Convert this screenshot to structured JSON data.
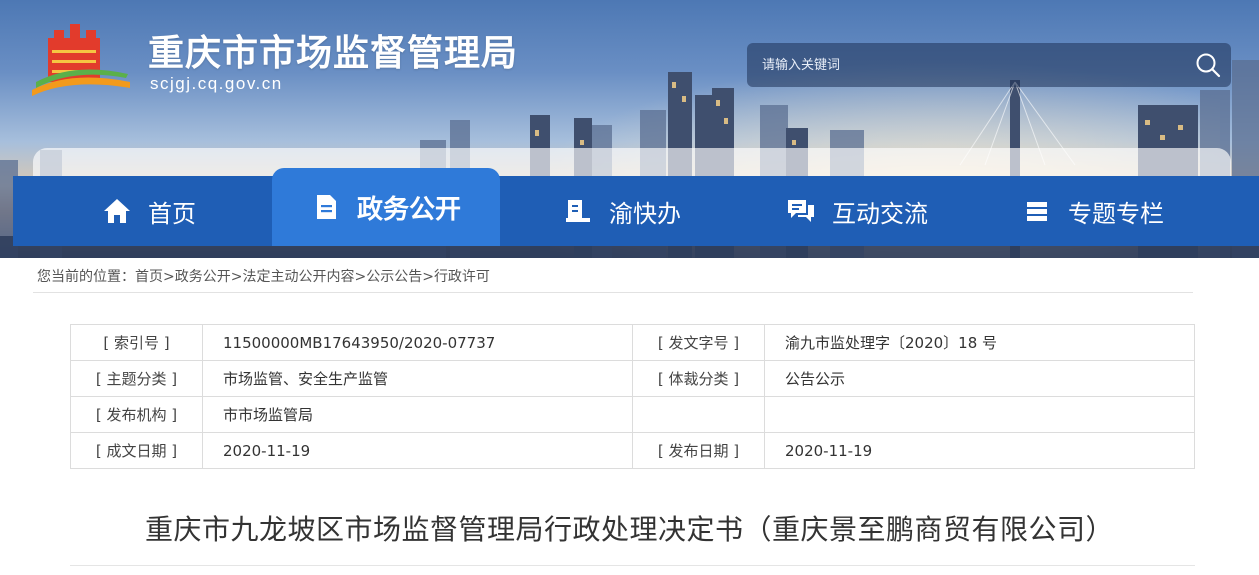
{
  "site": {
    "title": "重庆市市场监督管理局",
    "domain": "scjgj.cq.gov.cn"
  },
  "search": {
    "placeholder": "请输入关键词",
    "icon": "search-icon"
  },
  "nav": {
    "items": [
      {
        "label": "首页",
        "icon": "home-icon",
        "active": false
      },
      {
        "label": "政务公开",
        "icon": "document-icon",
        "active": true
      },
      {
        "label": "渝快办",
        "icon": "book-icon",
        "active": false
      },
      {
        "label": "互动交流",
        "icon": "chat-icon",
        "active": false
      },
      {
        "label": "专题专栏",
        "icon": "stack-icon",
        "active": false
      }
    ]
  },
  "breadcrumb": {
    "prefix": "您当前的位置：",
    "items": [
      "首页",
      "政务公开",
      "法定主动公开内容",
      "公示公告",
      "行政许可"
    ],
    "sep": ">"
  },
  "meta": {
    "rows": [
      {
        "label1": "[ 索引号 ]",
        "value1": "11500000MB17643950/2020-07737",
        "label2": "[ 发文字号 ]",
        "value2": "渝九市监处理字〔2020〕18 号"
      },
      {
        "label1": "[ 主题分类 ]",
        "value1": "市场监管、安全生产监管",
        "label2": "[ 体裁分类 ]",
        "value2": "公告公示"
      },
      {
        "label1": "[ 发布机构 ]",
        "value1": "市市场监管局",
        "label2": "",
        "value2": ""
      },
      {
        "label1": "[ 成文日期 ]",
        "value1": "2020-11-19",
        "label2": "[ 发布日期 ]",
        "value2": "2020-11-19"
      }
    ]
  },
  "document": {
    "title": "重庆市九龙坡区市场监督管理局行政处理决定书（重庆景至鹏商贸有限公司）"
  },
  "colors": {
    "nav_bg": "#1f5eb5",
    "nav_active": "#2f7ad9"
  }
}
